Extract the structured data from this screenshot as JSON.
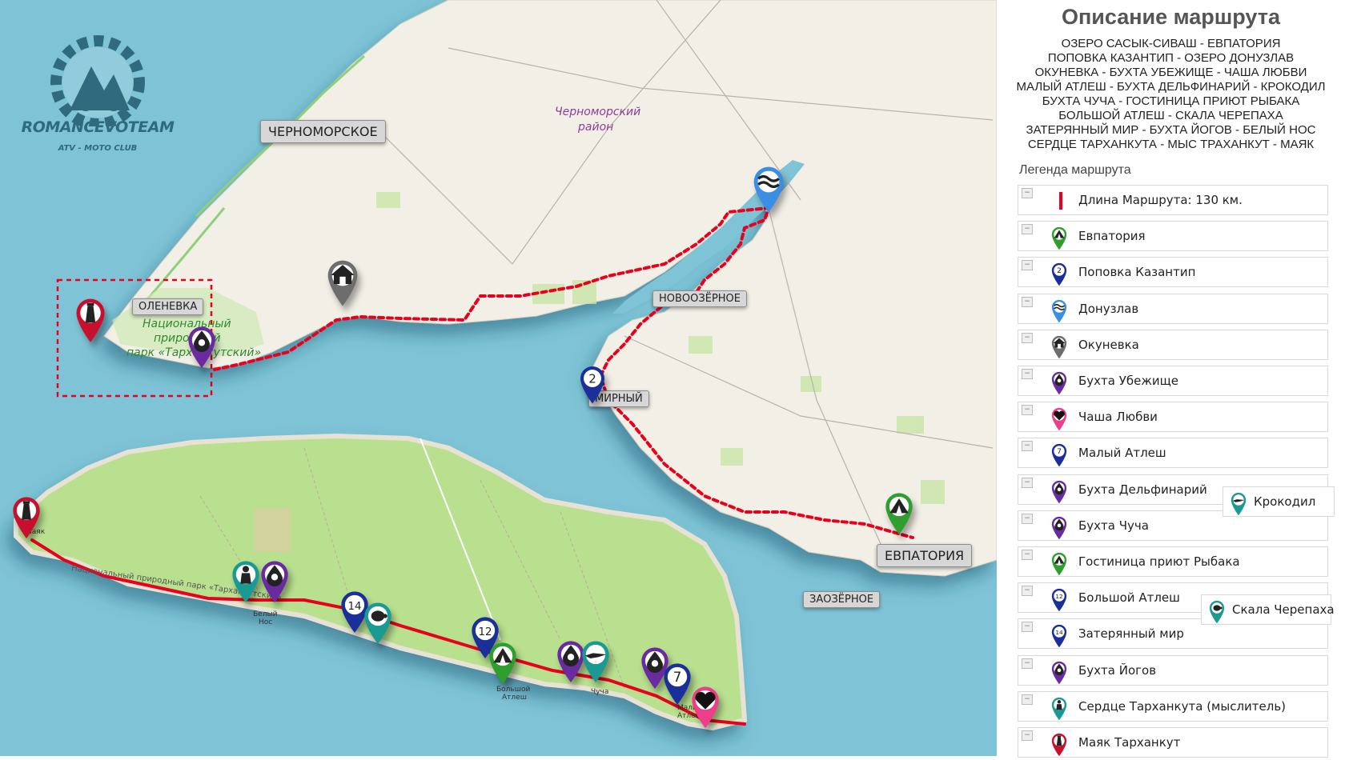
{
  "map": {
    "places": {
      "chernomorskoe": "ЧЕРНОМОРСКОЕ",
      "olenevka": "ОЛЕНЕВКА",
      "novoozernoe": "НОВООЗЁРНОЕ",
      "mirny": "МИРНЫЙ",
      "evpatoria": "ЕВПАТОРИЯ",
      "zaozernoe": "ЗАОЗЁРНОЕ"
    },
    "district_label": [
      "Черноморский",
      "район"
    ],
    "park_label": [
      "Национальный",
      "природный",
      "парк «Тарханкутский»"
    ],
    "inset_labels": {
      "mayak": "Маяк",
      "beliy_nos": [
        "Белый",
        "Нос"
      ],
      "bolshoy_atlesh": [
        "Большой",
        "Атлеш"
      ],
      "chucha": "Чуча",
      "maliy_atlesh": [
        "Малый",
        "Атлеш"
      ],
      "inset_park": "Национальный природный парк «Тарханкутский»"
    },
    "marker_numbers": {
      "mirny": "2",
      "zaterianny": "14",
      "bolshoy": "12",
      "maliy": "7"
    }
  },
  "logo": {
    "title": "ROMANCEVOTEAM",
    "subtitle": "ATV - MOTO CLUB"
  },
  "panel": {
    "title": "Описание маршрута",
    "route_lines": [
      "ОЗЕРО САСЫК-СИВАШ - ЕВПАТОРИЯ",
      "ПОПОВКА КАЗАНТИП - ОЗЕРО ДОНУЗЛАВ",
      "ОКУНЕВКА - БУХТА УБЕЖИЩЕ - ЧАША ЛЮБВИ",
      "МАЛЫЙ АТЛЕШ - БУХТА ДЕЛЬФИНАРИЙ - КРОКОДИЛ",
      "БУХТА ЧУЧА - ГОСТИНИЦА ПРИЮТ РЫБАКА",
      "БОЛЬШОЙ АТЛЕШ - СКАЛА ЧЕРЕПАХА",
      "ЗАТЕРЯННЫЙ МИР - БУХТА ЙОГОВ - БЕЛЫЙ НОС",
      "СЕРДЦЕ ТАРХАНКУТА - МЫС ТРАХАНКУТ - МАЯК"
    ],
    "legend_title": "Легенда маршрута",
    "toggle_symbol": "−",
    "legend": [
      {
        "label": "Длина Маршрута: 130 км.",
        "icon": "red-line-icon",
        "color": "#e8001c"
      },
      {
        "label": "Евпатория",
        "icon": "tent-pin-icon",
        "color": "#2e9e2e"
      },
      {
        "label": "Поповка Казантип",
        "icon": "number-2-pin-icon",
        "color": "#1a2f9a",
        "num": "2"
      },
      {
        "label": "Донузлав",
        "icon": "waves-pin-icon",
        "color": "#3a8ee6"
      },
      {
        "label": "Окуневка",
        "icon": "house-pin-icon",
        "color": "#6d6d6d"
      },
      {
        "label": "Бухта Убежище",
        "icon": "drop-pin-icon",
        "color": "#6a2aa0"
      },
      {
        "label": "Чаша Любви",
        "icon": "heart-pin-icon",
        "color": "#ee3d8a"
      },
      {
        "label": "Малый Атлеш",
        "icon": "number-7-pin-icon",
        "color": "#1a2f9a",
        "num": "7"
      },
      {
        "label": "Бухта Дельфинарий",
        "icon": "drop-pin-icon",
        "color": "#6a2aa0"
      },
      {
        "label": "Бухта Чуча",
        "icon": "drop-pin-icon",
        "color": "#6a2aa0"
      },
      {
        "label": "Гостиница приют Рыбака",
        "icon": "tent-pin-icon",
        "color": "#2e9e2e"
      },
      {
        "label": "Большой Атлеш",
        "icon": "number-12-pin-icon",
        "color": "#1a2f9a",
        "num": "12"
      },
      {
        "label": "Затерянный мир",
        "icon": "number-14-pin-icon",
        "color": "#1a2f9a",
        "num": "14"
      },
      {
        "label": "Бухта Йогов",
        "icon": "drop-pin-icon",
        "color": "#6a2aa0"
      },
      {
        "label": "Сердце Тарханкута (мыслитель)",
        "icon": "thinker-pin-icon",
        "color": "#1b9a94"
      },
      {
        "label": "Маяк Тарханкут",
        "icon": "lighthouse-pin-icon",
        "color": "#c8102e"
      }
    ],
    "float_items": [
      {
        "label": "Крокодил",
        "icon": "crocodile-pin-icon",
        "color": "#1b9a94"
      },
      {
        "label": "Скала Черепаха",
        "icon": "turtle-pin-icon",
        "color": "#1b9a94"
      }
    ]
  },
  "colors": {
    "sea": "#7fc3d6",
    "land": "#f2efe6",
    "park": "#b8e08f",
    "route": "#e8001c"
  }
}
